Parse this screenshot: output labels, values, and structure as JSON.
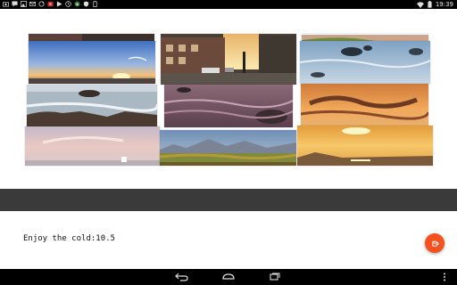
{
  "status_bar": {
    "time": "19:39",
    "left_icons": [
      "camera-icon",
      "chat-icon",
      "image-icon",
      "mail-icon",
      "sync-icon",
      "youtube-icon",
      "play-icon",
      "clock-icon",
      "download-icon",
      "shield-icon",
      "battery-saver-icon"
    ],
    "right_icons": [
      "wifi-icon",
      "battery-icon"
    ]
  },
  "collage": {
    "photos": [
      {
        "name": "photo-dark-rocks-top",
        "subject": "dark rocky shore"
      },
      {
        "name": "photo-street-buildings",
        "subject": "street with buildings at sunset"
      },
      {
        "name": "photo-green-coast",
        "subject": "green coastline"
      },
      {
        "name": "photo-sunset-beach",
        "subject": "sunset over beach"
      },
      {
        "name": "photo-sea-rocks-blue",
        "subject": "rocks in blue sea"
      },
      {
        "name": "photo-rocky-waves",
        "subject": "waves over rocky shore"
      },
      {
        "name": "photo-pink-rocks",
        "subject": "pink water over rocks"
      },
      {
        "name": "photo-orange-clouds",
        "subject": "orange cloudy sky"
      },
      {
        "name": "photo-pastel-sky",
        "subject": "pastel evening sky"
      },
      {
        "name": "photo-mountain-valley",
        "subject": "mountain valley"
      },
      {
        "name": "photo-golden-sunset",
        "subject": "golden sunset over sea"
      }
    ]
  },
  "panel": {
    "score_text": "Enjoy the cold:10.5",
    "fab_icon": "cup-icon",
    "fab_color": "#f4511e"
  },
  "nav_bar": {
    "buttons": [
      "back-icon",
      "home-icon",
      "recents-icon",
      "overflow-icon"
    ]
  }
}
